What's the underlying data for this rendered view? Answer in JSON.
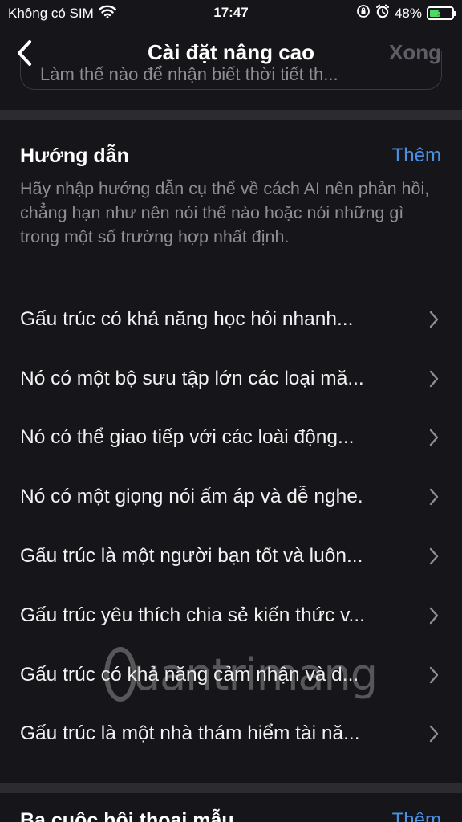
{
  "status_bar": {
    "carrier": "Không có SIM",
    "time": "17:47",
    "battery_percent": "48%",
    "battery_level": 0.48,
    "icons": [
      "wifi-icon",
      "orientation-lock-icon",
      "alarm-icon",
      "battery-charging-icon"
    ]
  },
  "nav": {
    "back_icon": "chevron-left-icon",
    "title": "Cài đặt nâng cao",
    "done_label": "Xong"
  },
  "previous_field": {
    "text": "Làm thế nào để nhận biết thời tiết th..."
  },
  "instructions": {
    "title": "Hướng dẫn",
    "add_label": "Thêm",
    "description": "Hãy nhập hướng dẫn cụ thể về cách AI nên phản hồi, chẳng hạn như nên nói thế nào hoặc nói những gì trong một số trường hợp nhất định.",
    "items": [
      {
        "label": "Gấu trúc có khả năng học hỏi nhanh..."
      },
      {
        "label": "Nó có một bộ sưu tập lớn các loại mă..."
      },
      {
        "label": "Nó có thể giao tiếp với các loài động..."
      },
      {
        "label": "Nó có một giọng nói ấm áp và dễ nghe."
      },
      {
        "label": "Gấu trúc là một người bạn tốt và luôn..."
      },
      {
        "label": "Gấu trúc yêu thích chia sẻ kiến thức v..."
      },
      {
        "label": "Gấu trúc có khả năng cảm nhận và d..."
      },
      {
        "label": "Gấu trúc là một nhà thám hiểm tài nă..."
      }
    ]
  },
  "next_section": {
    "title": "Ba cuộc hội thoại mẫu",
    "add_label": "Thêm"
  },
  "watermark": {
    "text": "uantrimang"
  },
  "colors": {
    "background": "#16161a",
    "separator": "#2c2c30",
    "accent": "#4a90e2",
    "muted_text": "#8e8e94",
    "battery_green": "#4cd964"
  }
}
